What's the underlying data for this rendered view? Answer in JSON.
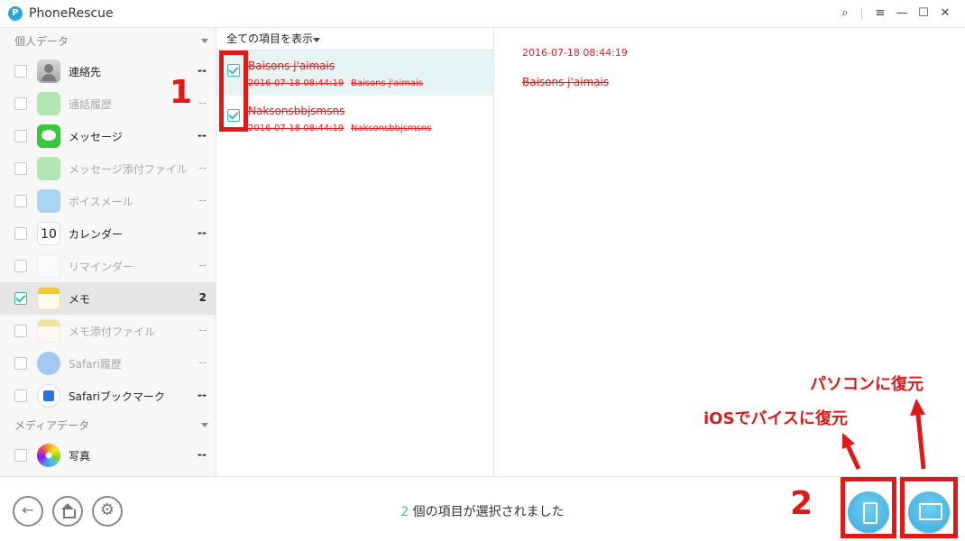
{
  "app": {
    "title": "PhoneRescue",
    "logo_letter": "P"
  },
  "window_controls": {
    "search": "⌕",
    "menu": "≡",
    "minimize": "—",
    "maximize": "☐",
    "close": "✕"
  },
  "sidebar": {
    "section_personal": "個人データ",
    "section_media": "メディアデータ",
    "items": [
      {
        "label": "連絡先",
        "count": "--",
        "enabled": true,
        "checked": false,
        "icon": "contacts-icon"
      },
      {
        "label": "通話履歴",
        "count": "--",
        "enabled": false,
        "checked": false,
        "icon": "phone-icon"
      },
      {
        "label": "メッセージ",
        "count": "--",
        "enabled": true,
        "checked": false,
        "icon": "messages-icon"
      },
      {
        "label": "メッセージ添付ファイル",
        "count": "--",
        "enabled": false,
        "checked": false,
        "icon": "message-attachment-icon"
      },
      {
        "label": "ボイスメール",
        "count": "--",
        "enabled": false,
        "checked": false,
        "icon": "voicemail-icon"
      },
      {
        "label": "カレンダー",
        "count": "--",
        "enabled": true,
        "checked": false,
        "icon": "calendar-icon",
        "icon_text": "10"
      },
      {
        "label": "リマインダー",
        "count": "--",
        "enabled": false,
        "checked": false,
        "icon": "reminders-icon"
      },
      {
        "label": "メモ",
        "count": "2",
        "enabled": true,
        "checked": true,
        "icon": "notes-icon"
      },
      {
        "label": "メモ添付ファイル",
        "count": "--",
        "enabled": false,
        "checked": false,
        "icon": "notes-attachment-icon"
      },
      {
        "label": "Safari履歴",
        "count": "--",
        "enabled": false,
        "checked": false,
        "icon": "safari-history-icon"
      },
      {
        "label": "Safariブックマーク",
        "count": "--",
        "enabled": true,
        "checked": false,
        "icon": "safari-bookmark-icon"
      }
    ],
    "media_items": [
      {
        "label": "写真",
        "count": "--",
        "enabled": true,
        "checked": false,
        "icon": "photos-icon"
      }
    ]
  },
  "list": {
    "filter_label": "全ての項目を表示",
    "rows": [
      {
        "title": "Baisons j'aimais",
        "date": "2016-07-18 08:44:19",
        "preview": "Baisons j'aimais",
        "checked": true
      },
      {
        "title": "Naksonsbbjsmsns",
        "date": "2016-07-18 08:44:19",
        "preview": "Naksonsbbjsmsns",
        "checked": true
      }
    ]
  },
  "detail": {
    "date": "2016-07-18 08:44:19",
    "body": "Baisons j'aimais"
  },
  "footer": {
    "status_count": "2",
    "status_text": " 個の項目が選択されました"
  },
  "annotations": {
    "step1": "1",
    "step2": "2",
    "to_ios": "iOSでバイスに復元",
    "to_pc": "パソコンに復元"
  },
  "colors": {
    "accent": "#3cbcb0",
    "deleted_text": "#e02020",
    "annotation": "#e01818",
    "restore_button": "#3ca8dd"
  }
}
